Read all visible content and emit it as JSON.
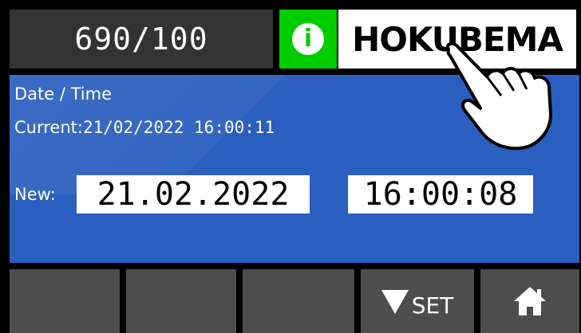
{
  "header": {
    "counter": "690/100",
    "info_icon": "info-icon",
    "logo_text": "HOKUBEMA"
  },
  "panel": {
    "title": "Date / Time",
    "current_label": "Current:",
    "current_value": "21/02/2022 16:00:11",
    "new_label": "New:",
    "new_date": "21.02.2022",
    "new_time": "16:00:08"
  },
  "buttons": {
    "set_label": "SET",
    "set_icon": "triangle-down-icon",
    "home_icon": "home-icon"
  },
  "colors": {
    "background": "#000000",
    "header_counter": "#333333",
    "info_green": "#00cc00",
    "panel_blue": "#2a5fbf",
    "button_gray": "#4d4d4d"
  }
}
